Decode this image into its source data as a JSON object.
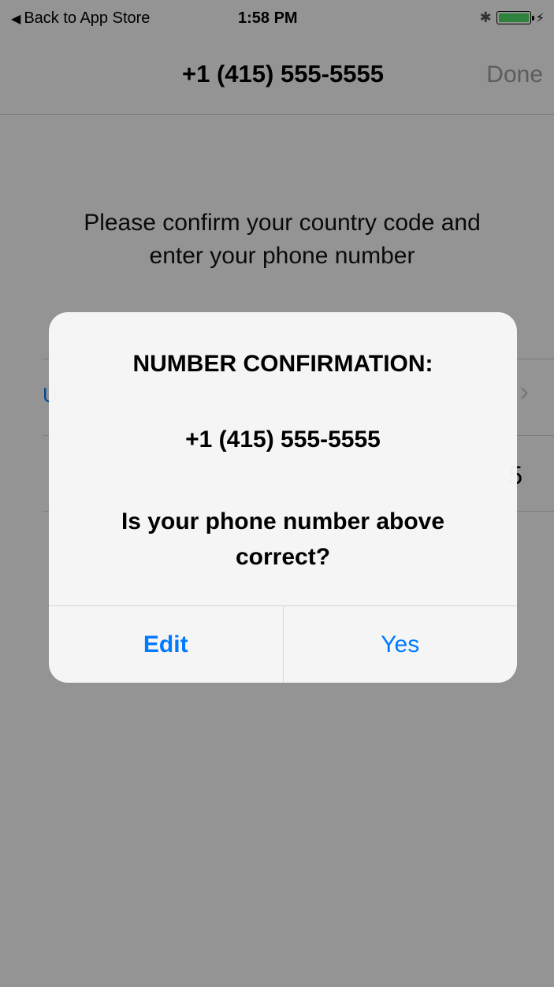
{
  "status_bar": {
    "back_label": "Back to App Store",
    "time": "1:58 PM",
    "bluetooth_icon": "bluetooth-icon",
    "battery_icon": "battery-icon",
    "charging_icon": "bolt-icon"
  },
  "nav": {
    "title": "+1 (415) 555-5555",
    "done_label": "Done"
  },
  "instructions": {
    "line1": "Please confirm your country code and",
    "line2": "enter your phone number"
  },
  "background_rows": {
    "country_partial": "U",
    "number_partial": "5"
  },
  "alert": {
    "title": "NUMBER CONFIRMATION:",
    "number": "+1 (415) 555-5555",
    "question_line1": "Is your phone number above",
    "question_line2": "correct?",
    "edit_label": "Edit",
    "yes_label": "Yes"
  },
  "colors": {
    "accent": "#007aff",
    "battery": "#4cd964"
  }
}
